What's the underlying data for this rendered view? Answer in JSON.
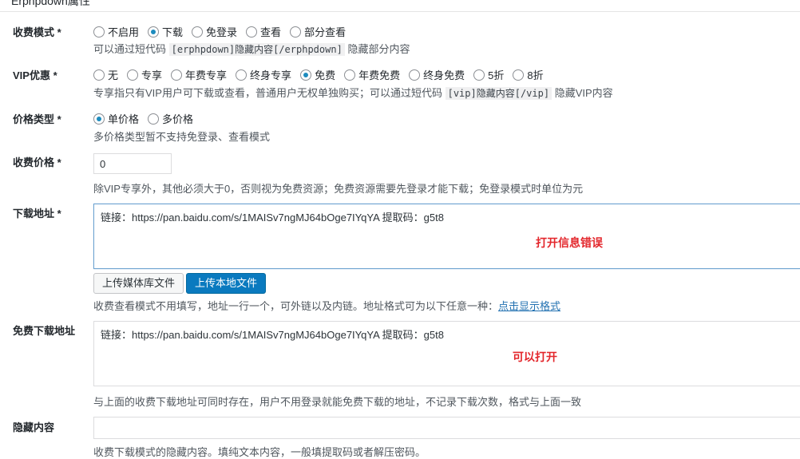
{
  "header": {
    "title": "Erphpdown属性"
  },
  "fee_mode": {
    "label": "收费模式 *",
    "options": [
      "不启用",
      "下载",
      "免登录",
      "查看",
      "部分查看"
    ],
    "selected": "下载",
    "desc_prefix": "可以通过短代码",
    "desc_code": "[erphpdown]隐藏内容[/erphpdown]",
    "desc_suffix": "隐藏部分内容"
  },
  "vip": {
    "label": "VIP优惠 *",
    "options": [
      "无",
      "专享",
      "年费专享",
      "终身专享",
      "免费",
      "年费免费",
      "终身免费",
      "5折",
      "8折"
    ],
    "selected": "免费",
    "desc_prefix": "专享指只有VIP用户可下载或查看，普通用户无权单独购买；可以通过短代码",
    "desc_code": "[vip]隐藏内容[/vip]",
    "desc_suffix": "隐藏VIP内容"
  },
  "price_type": {
    "label": "价格类型 *",
    "options": [
      "单价格",
      "多价格"
    ],
    "selected": "单价格",
    "desc": "多价格类型暂不支持免登录、查看模式"
  },
  "price": {
    "label": "收费价格 *",
    "value": "0",
    "desc": "除VIP专享外，其他必须大于0，否则视为免费资源；免费资源需要先登录才能下载；免登录模式时单位为元"
  },
  "download_url": {
    "label": "下载地址 *",
    "value": "链接：https://pan.baidu.com/s/1MAISv7ngMJ64bOge7IYqYA 提取码：g5t8",
    "annotation": "打开信息错误",
    "upload_media_label": "上传媒体库文件",
    "upload_local_label": "上传本地文件",
    "desc": "收费查看模式不用填写，地址一行一个，可外链以及内链。地址格式可为以下任意一种：",
    "desc_link": "点击显示格式"
  },
  "free_download_url": {
    "label": "免费下载地址",
    "value": "链接：https://pan.baidu.com/s/1MAISv7ngMJ64bOge7IYqYA 提取码：g5t8",
    "annotation": "可以打开",
    "desc": "与上面的收费下载地址可同时存在，用户不用登录就能免费下载的地址，不记录下载次数，格式与上面一致"
  },
  "hidden_content": {
    "label": "隐藏内容",
    "value": "",
    "desc": "收费下载模式的隐藏内容。填纯文本内容，一般填提取码或者解压密码。"
  },
  "colors": {
    "accent": "#0a7abf",
    "annotation": "#e3262b",
    "link": "#2271b1"
  }
}
